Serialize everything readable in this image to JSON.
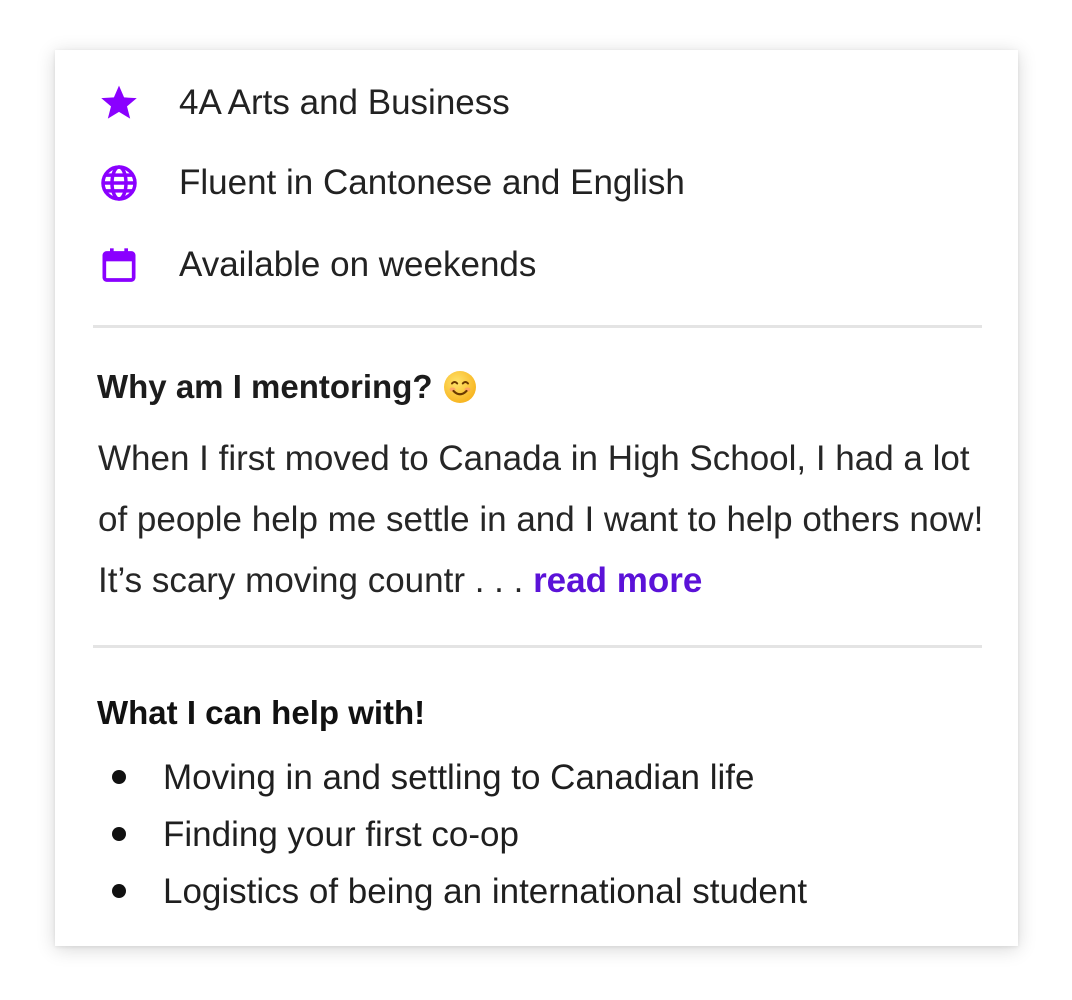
{
  "colors": {
    "accent": "#8a00ff",
    "link": "#5b12d8",
    "divider": "#e4e4e4",
    "text": "#222222"
  },
  "profile": {
    "details": [
      {
        "icon": "star-icon",
        "text": "4A Arts and Business"
      },
      {
        "icon": "globe-icon",
        "text": "Fluent in Cantonese and English"
      },
      {
        "icon": "calendar-icon",
        "text": "Available on weekends"
      }
    ]
  },
  "why_section": {
    "title": "Why am I mentoring?",
    "emoji": "smiling-face-emoji",
    "body": "When I first moved to Canada in High School, I had a lot of people help me settle in and I want to help others now! It’s scary moving countr . . . ",
    "read_more_label": "read more"
  },
  "help_section": {
    "title": "What I can help with!",
    "items": [
      "Moving in and settling to Canadian life",
      "Finding your first co-op",
      "Logistics of being an international student"
    ]
  }
}
